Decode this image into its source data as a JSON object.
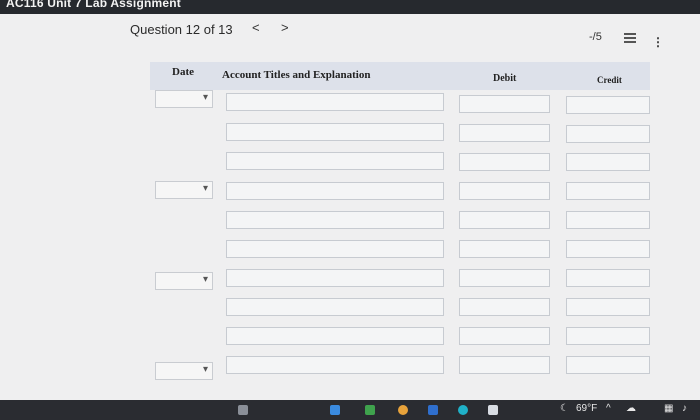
{
  "window": {
    "title": "AC116 Unit 7 Lab Assignment"
  },
  "question": {
    "label": "Question 12 of 13",
    "prev": "<",
    "next": ">"
  },
  "score": {
    "value": "-/5"
  },
  "table": {
    "headers": {
      "date": "Date",
      "account": "Account Titles and Explanation",
      "debit": "Debit",
      "credit": "Credit"
    },
    "date_selects": [
      {
        "value": ""
      },
      {
        "value": ""
      },
      {
        "value": ""
      },
      {
        "value": ""
      }
    ],
    "rows": [
      {
        "account": "",
        "debit": "",
        "credit": ""
      },
      {
        "account": "",
        "debit": "",
        "credit": ""
      },
      {
        "account": "",
        "debit": "",
        "credit": ""
      },
      {
        "account": "",
        "debit": "",
        "credit": ""
      },
      {
        "account": "",
        "debit": "",
        "credit": ""
      },
      {
        "account": "",
        "debit": "",
        "credit": ""
      },
      {
        "account": "",
        "debit": "",
        "credit": ""
      },
      {
        "account": "",
        "debit": "",
        "credit": ""
      },
      {
        "account": "",
        "debit": "",
        "credit": ""
      },
      {
        "account": "",
        "debit": "",
        "credit": ""
      }
    ]
  },
  "taskbar": {
    "weather": "69°F",
    "icons": [
      "app-icon-1",
      "app-icon-2",
      "app-icon-3",
      "app-icon-4",
      "app-icon-5",
      "app-icon-6",
      "app-icon-7"
    ]
  }
}
